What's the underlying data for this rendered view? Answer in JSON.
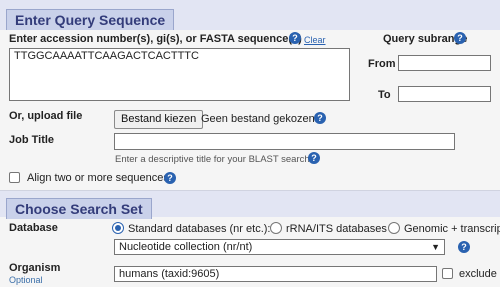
{
  "query_section": {
    "title": "Enter Query Sequence",
    "accession_label": "Enter accession number(s), gi(s), or FASTA sequence(s)",
    "clear_link": "Clear",
    "sequence_value": "TTGGCAAAATTCAAGACTCACTTTC",
    "subrange": {
      "title": "Query subrange",
      "from_label": "From",
      "to_label": "To",
      "from_value": "",
      "to_value": ""
    },
    "upload": {
      "label": "Or, upload file",
      "button_label": "Bestand kiezen",
      "status_text": "Geen bestand gekozen"
    },
    "job_title": {
      "label": "Job Title",
      "value": "",
      "hint": "Enter a descriptive title for your BLAST search"
    },
    "align_two_label": "Align two or more sequences"
  },
  "search_set": {
    "title": "Choose Search Set",
    "database_label": "Database",
    "db_options": [
      {
        "label": "Standard databases (nr etc.):",
        "selected": true
      },
      {
        "label": "rRNA/ITS databases",
        "selected": false
      },
      {
        "label": "Genomic + transcript",
        "selected": false
      }
    ],
    "collection_value": "Nucleotide collection (nr/nt)",
    "organism_label": "Organism",
    "organism_optional": "Optional",
    "organism_value": "humans (taxid:9605)",
    "exclude_label": "exclude"
  },
  "icons": {
    "help": "help-icon",
    "dropdown": "chevron-down-icon"
  },
  "colors": {
    "accent": "#2a62b0",
    "header_band": "#e2e5f3",
    "section_tab": "#c9d1ea"
  }
}
